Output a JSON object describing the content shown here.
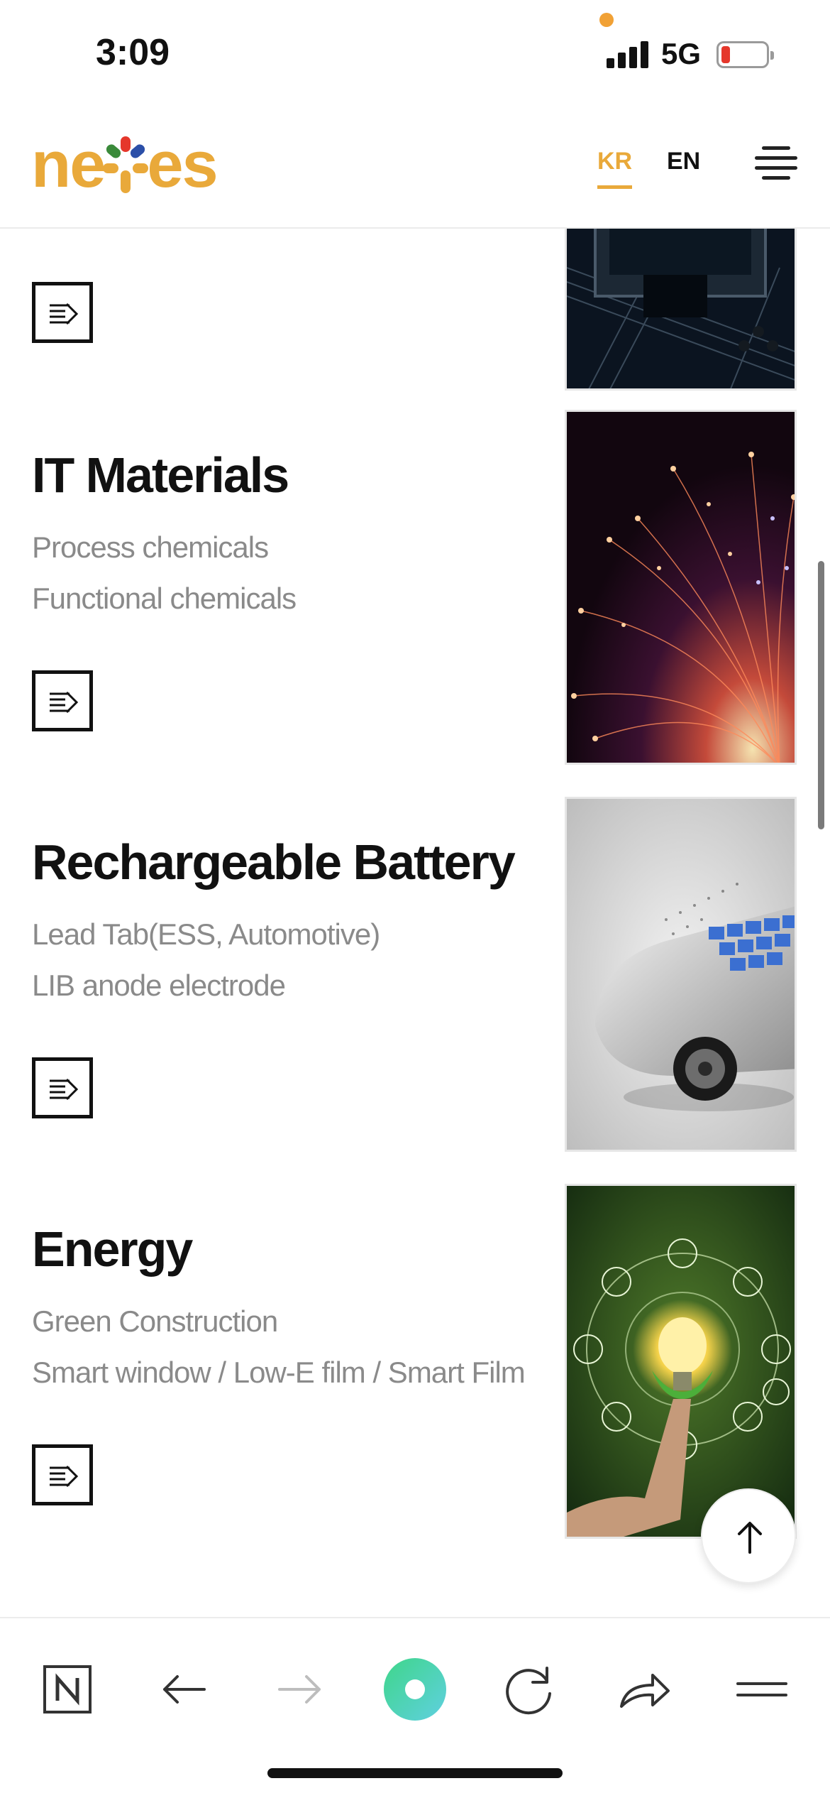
{
  "status_bar": {
    "time": "3:09",
    "network": "5G",
    "battery_level": 0.15
  },
  "header": {
    "logo_text_left": "ne",
    "logo_text_right": "es",
    "lang_kr": "KR",
    "lang_en": "EN",
    "accent_color": "#e9a93a"
  },
  "sections": [
    {
      "title": "",
      "items": [],
      "image": "semiconductor-chip-image"
    },
    {
      "title": "IT Materials",
      "items": [
        "Process chemicals",
        "Functional chemicals"
      ],
      "image": "fiber-optics-image"
    },
    {
      "title": "Rechargeable Battery",
      "items": [
        "Lead Tab(ESS, Automotive)",
        "LIB anode electrode"
      ],
      "image": "electric-car-image"
    },
    {
      "title": "Energy",
      "items": [
        "Green Construction",
        "Smart window / Low-E film / Smart Film"
      ],
      "image": "green-energy-lightbulb-image"
    }
  ],
  "browser_toolbar": {
    "icons": [
      "naver-n-icon",
      "back-arrow-icon",
      "forward-arrow-icon",
      "green-dot-icon",
      "reload-icon",
      "share-icon",
      "menu-icon"
    ]
  }
}
